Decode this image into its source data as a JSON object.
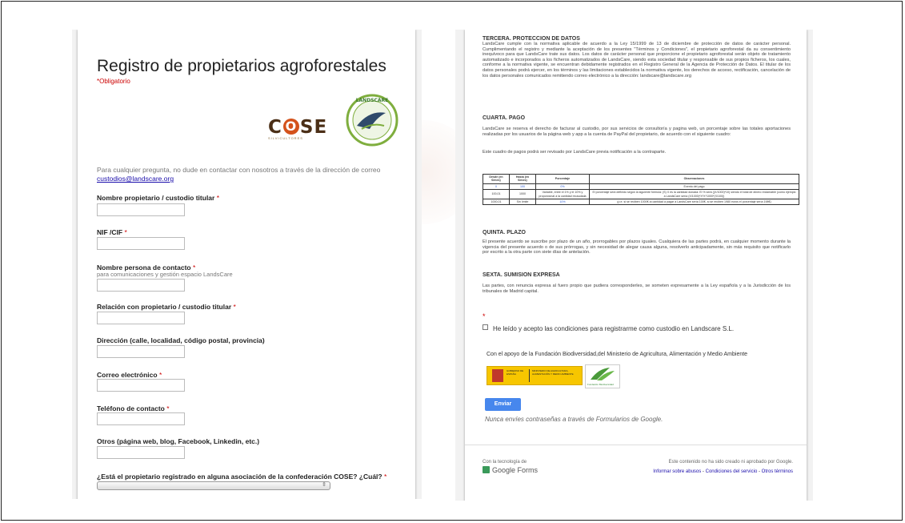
{
  "form": {
    "title": "Registro de propietarios agroforestales",
    "required_note": "*Obligatorio",
    "cose_logo_text": "COSE",
    "cose_subtitle": "SILVICULTORES",
    "landscare_logo_text": "LANDSCARE",
    "intro_text": "Para cualquier pregunta, no dude en contactar con nosotros a través de la dirección de correo",
    "intro_email": "custodios@landscare.org",
    "questions": [
      {
        "label": "Nombre propietario / custodio titular",
        "required": "*"
      },
      {
        "label": "NIF /CIF",
        "required": "*"
      },
      {
        "label": "Nombre persona de contacto",
        "required": "*",
        "help": "para comunicaciones y gestión espacio LandsCare"
      },
      {
        "label": "Relación con propietario / custodio titular",
        "required": "*"
      },
      {
        "label": "Dirección (calle, localidad, código postal, provincia)",
        "required": ""
      },
      {
        "label": "Correo electrónico",
        "required": "*"
      },
      {
        "label": "Teléfono de contacto",
        "required": "*"
      },
      {
        "label": "Otros (página web, blog, Facebook, Linkedin, etc.)",
        "required": ""
      },
      {
        "label": "¿Está el propietario registrado en alguna asociación de la confederación COSE? ¿Cuál?",
        "required": "*"
      }
    ]
  },
  "terms": {
    "section3_title": "TERCERA. PROTECCION DE DATOS",
    "section3_text": "LandsCare cumple con la normativa aplicable de acuerdo a la Ley 15/1999 de 13 de diciembre de protección de datos de carácter personal. Cumplimentando el registro y mediante la aceptación de los presentes \"Términos y Condiciones\", el propietario agroforestal da su consentimiento inequívoco para que LandsCare trate sus datos. Los datos de carácter personal que proporcione el propietario agroforestal serán objeto de tratamiento automatizado e incorporados a los ficheros automatizados de LandsCare, siendo esta sociedad titular y responsable de sus propios ficheros, los cuales, conforme a la normativa vigente, se encuentran debidamente registrados en el Registro General de la Agencia de Protección de Datos. El titular de los datos personales podrá ejercer, en los términos y las limitaciones establecidos la normativa vigente, los derechos de acceso, rectificación, cancelación de los datos personales comunicados remitiendo correo electrónico a la dirección: landscare@landscare.org",
    "section4_title": "CUARTA. PAGO",
    "section4_text": "LandsCare se reserva el derecho de facturar al custodio, por sus servicios de consultoría y pagina web, un porcentaje sobre las totales aportaciones realizadas por los usuarios de la página web y app a la cuenta de PayPal del propietario, de acuerdo con el siguiente cuadro:",
    "section4_note": "Este cuadro de pagos podrá ser revisado por LandsCare previa notificación a la contraparte.",
    "table_headers": [
      "Desde (en €/mes)",
      "Hasta (en €/mes)",
      "Porcentaje",
      "Observaciones"
    ],
    "table_rows": [
      [
        "0",
        "100",
        "0%",
        "Exento del pago"
      ],
      [
        "100,01",
        "1000",
        "Variable, entre el 1% y el 10% y proporcional a la cantidad recaudada",
        "El porcentaje será definido según la siguiente fórmula: (S) X es la cantidad donada: El % será ((X/1000)*10) siendo el total de dinero reclamable (como ejemplo a LandsCare sería (X/1000)*X*X*1000*(X/100))"
      ],
      [
        "1000,01",
        "Sin límite",
        "10%",
        "(p.e. si se reciben 1000€ la cantidad a pagar a LandsCare sería 100€, si se reciben 1980 euros el porcentaje sería 198€)"
      ]
    ],
    "section5_title": "QUINTA. PLAZO",
    "section5_text": "El presente acuerdo se suscribe por plazo de un año, prorrogables por plazos iguales. Cualquiera de las partes podrá, en cualquier momento durante la vigencia del presente acuerdo o de sus prórrogas, y sin necesidad de alegar causa alguna, resolverlo anticipadamente, sin más requisito que notificarlo por escrito a la otra parte con siete días de antelación.",
    "section6_title": "SEXTA. SUMISION EXPRESA",
    "section6_text": "Las partes, con renuncia expresa al fuero propio que pudiera corresponderles, se someten expresamente a la Ley española y a la Jurisdicción de los tribunales de Madrid capital.",
    "required_star": "*",
    "accept_label": "He leído y acepto las condiciones para registrarme como custodio en Landscare S.L.",
    "support_text": "Con el apoyo de la Fundación Biodiversidad,del Ministerio de Agricultura, Alimentación y Medio Ambiente",
    "gov_logo_text": "GOBIERNO DE ESPAÑA",
    "ministry_text": "MINISTERIO DE AGRICULTURA, ALIMENTACIÓN Y MEDIO AMBIENTE",
    "fb_logo_text": "Fundación Biodiversidad",
    "submit_label": "Enviar",
    "password_warning": "Nunca envíes contraseñas a través de Formularios de Google.",
    "powered_by": "Con la tecnología de",
    "google_forms": "Google Forms",
    "disclaimer": "Este contenido no ha sido creado ni aprobado por Google.",
    "link_abuse": "Informar sobre abusos",
    "link_terms": "Condiciones del servicio",
    "link_other": "Otros términos",
    "link_sep": " - "
  },
  "colors": {
    "accent_blue": "#4787ed",
    "required_red": "#cc0000",
    "cose_orange": "#d4521b",
    "cose_brown": "#4b2f17"
  }
}
